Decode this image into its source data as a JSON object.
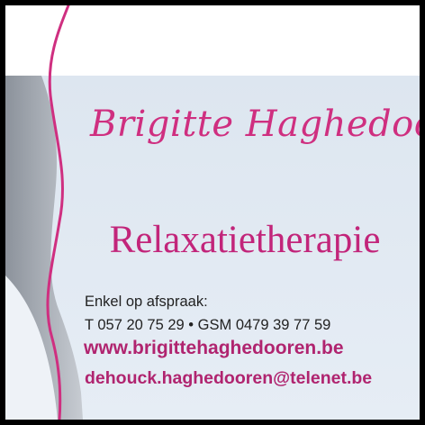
{
  "card": {
    "name": "Brigitte Haghedooren",
    "service": "Relaxatietherapie",
    "appointment": "Enkel op afspraak:",
    "phones": "T 057 20 75 29 • GSM 0479 39 77 59",
    "website": "www.brigittehaghedooren.be",
    "email": "dehouck.haghedooren@telenet.be"
  },
  "colors": {
    "frame": "#000000",
    "accent_pink": "#cf2f80",
    "background_blue": "#dfe8f2",
    "swoosh_grey": "#a8adb5",
    "text_dark": "#222222"
  }
}
